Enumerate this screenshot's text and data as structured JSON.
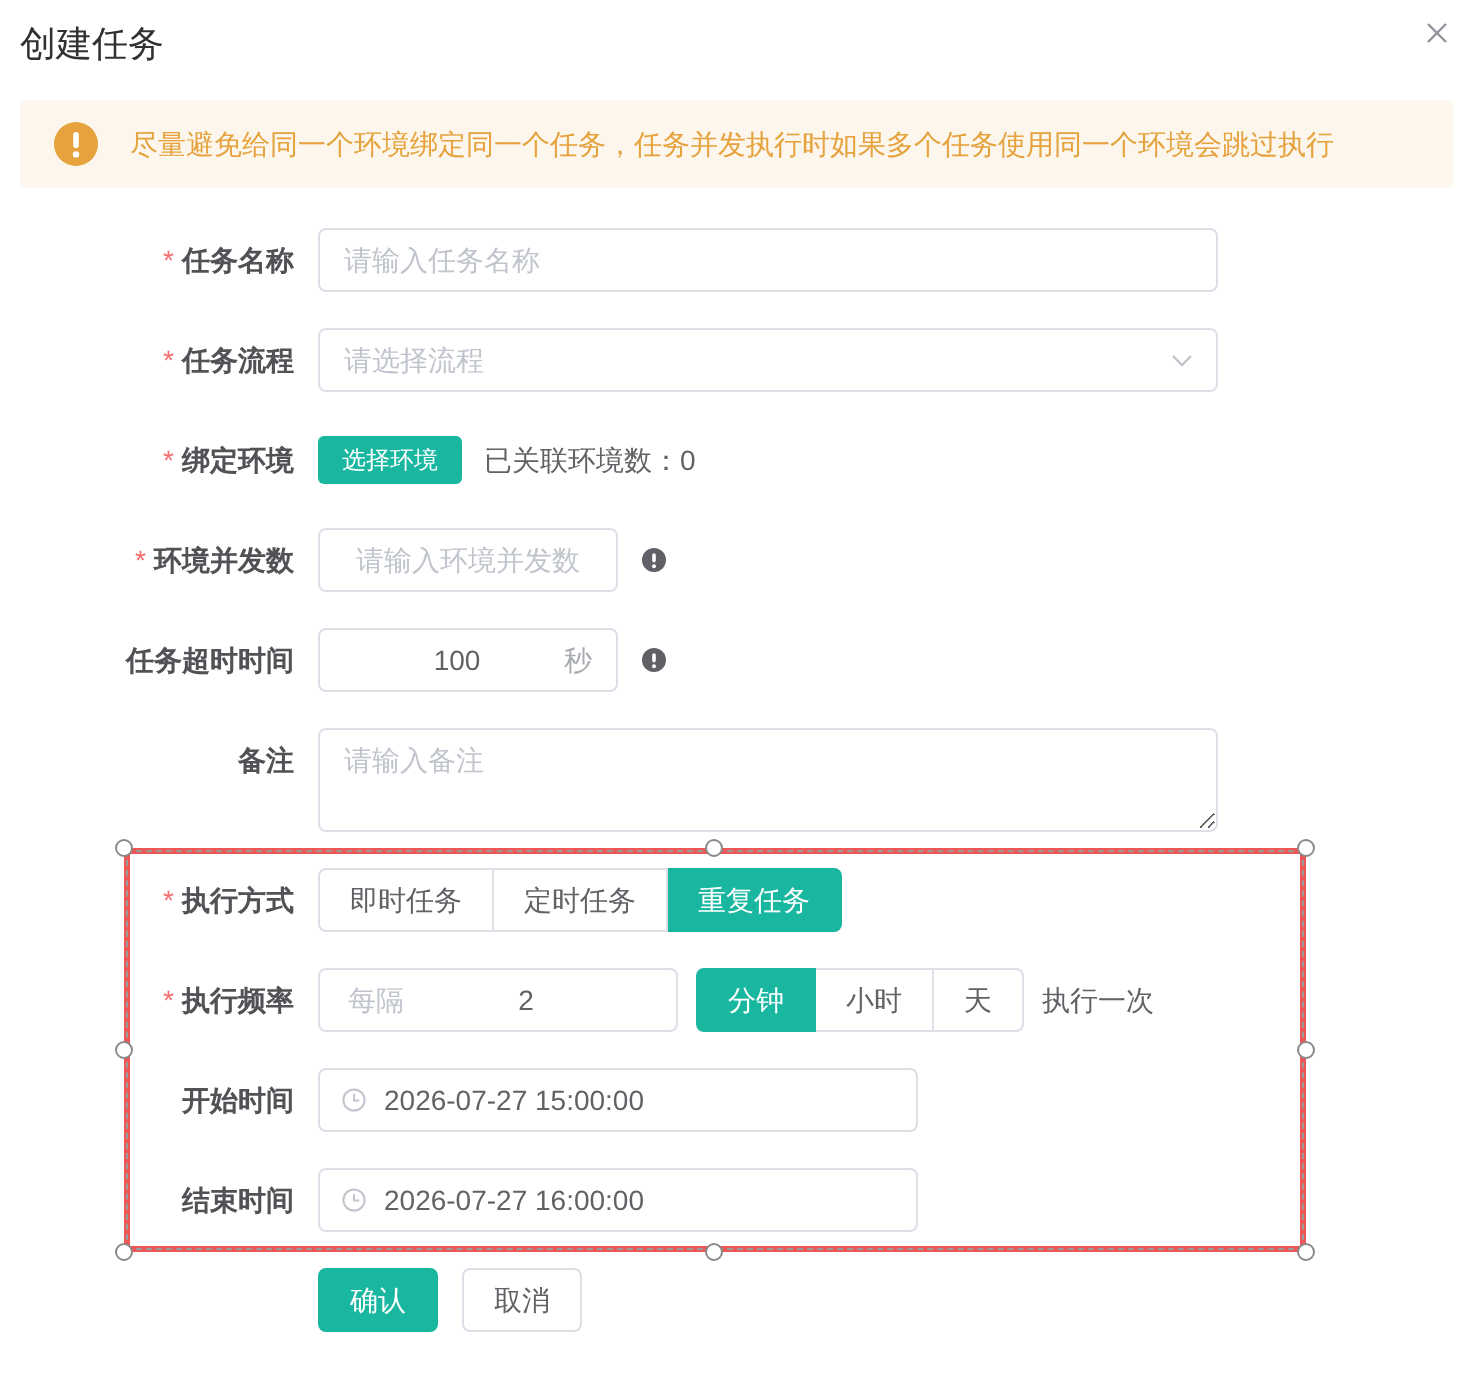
{
  "dialog": {
    "title": "创建任务"
  },
  "alert": {
    "text": "尽量避免给同一个环境绑定同一个任务，任务并发执行时如果多个任务使用同一个环境会跳过执行"
  },
  "form": {
    "fields": [
      {
        "kind": "text",
        "required_mark": "*",
        "label": "任务名称",
        "placeholder": "请输入任务名称"
      },
      {
        "kind": "select",
        "required_mark": "*",
        "label": "任务流程",
        "placeholder": "请选择流程"
      },
      {
        "kind": "binding",
        "required_mark": "*",
        "label": "绑定环境",
        "button": "选择环境",
        "note": "已关联环境数：0"
      },
      {
        "kind": "number",
        "required_mark": "*",
        "label": "环境并发数",
        "placeholder": "请输入环境并发数"
      },
      {
        "kind": "number",
        "label": "任务超时时间",
        "value": "100",
        "suffix": "秒"
      },
      {
        "kind": "textarea",
        "label": "备注",
        "placeholder": "请输入备注"
      }
    ],
    "schedule": {
      "selected": true,
      "fields": [
        {
          "kind": "radio",
          "required_mark": "*",
          "label": "执行方式",
          "options": [
            {
              "label": "即时任务",
              "selected": false
            },
            {
              "label": "定时任务",
              "selected": false
            },
            {
              "label": "重复任务",
              "selected": true
            }
          ]
        },
        {
          "kind": "interval",
          "required_mark": "*",
          "label": "执行频率",
          "prefix": "每隔",
          "value": "2",
          "options": [
            {
              "label": "分钟",
              "selected": true
            },
            {
              "label": "小时",
              "selected": false
            },
            {
              "label": "天",
              "selected": false
            }
          ],
          "note": "执行一次"
        },
        {
          "kind": "datetime",
          "label": "开始时间",
          "value": "2026-07-27 15:00:00"
        },
        {
          "kind": "datetime",
          "label": "结束时间",
          "value": "2026-07-27 16:00:00"
        }
      ]
    }
  },
  "actions": [
    {
      "kind": "primary",
      "label": "确认"
    },
    {
      "kind": "default",
      "label": "取消"
    }
  ]
}
